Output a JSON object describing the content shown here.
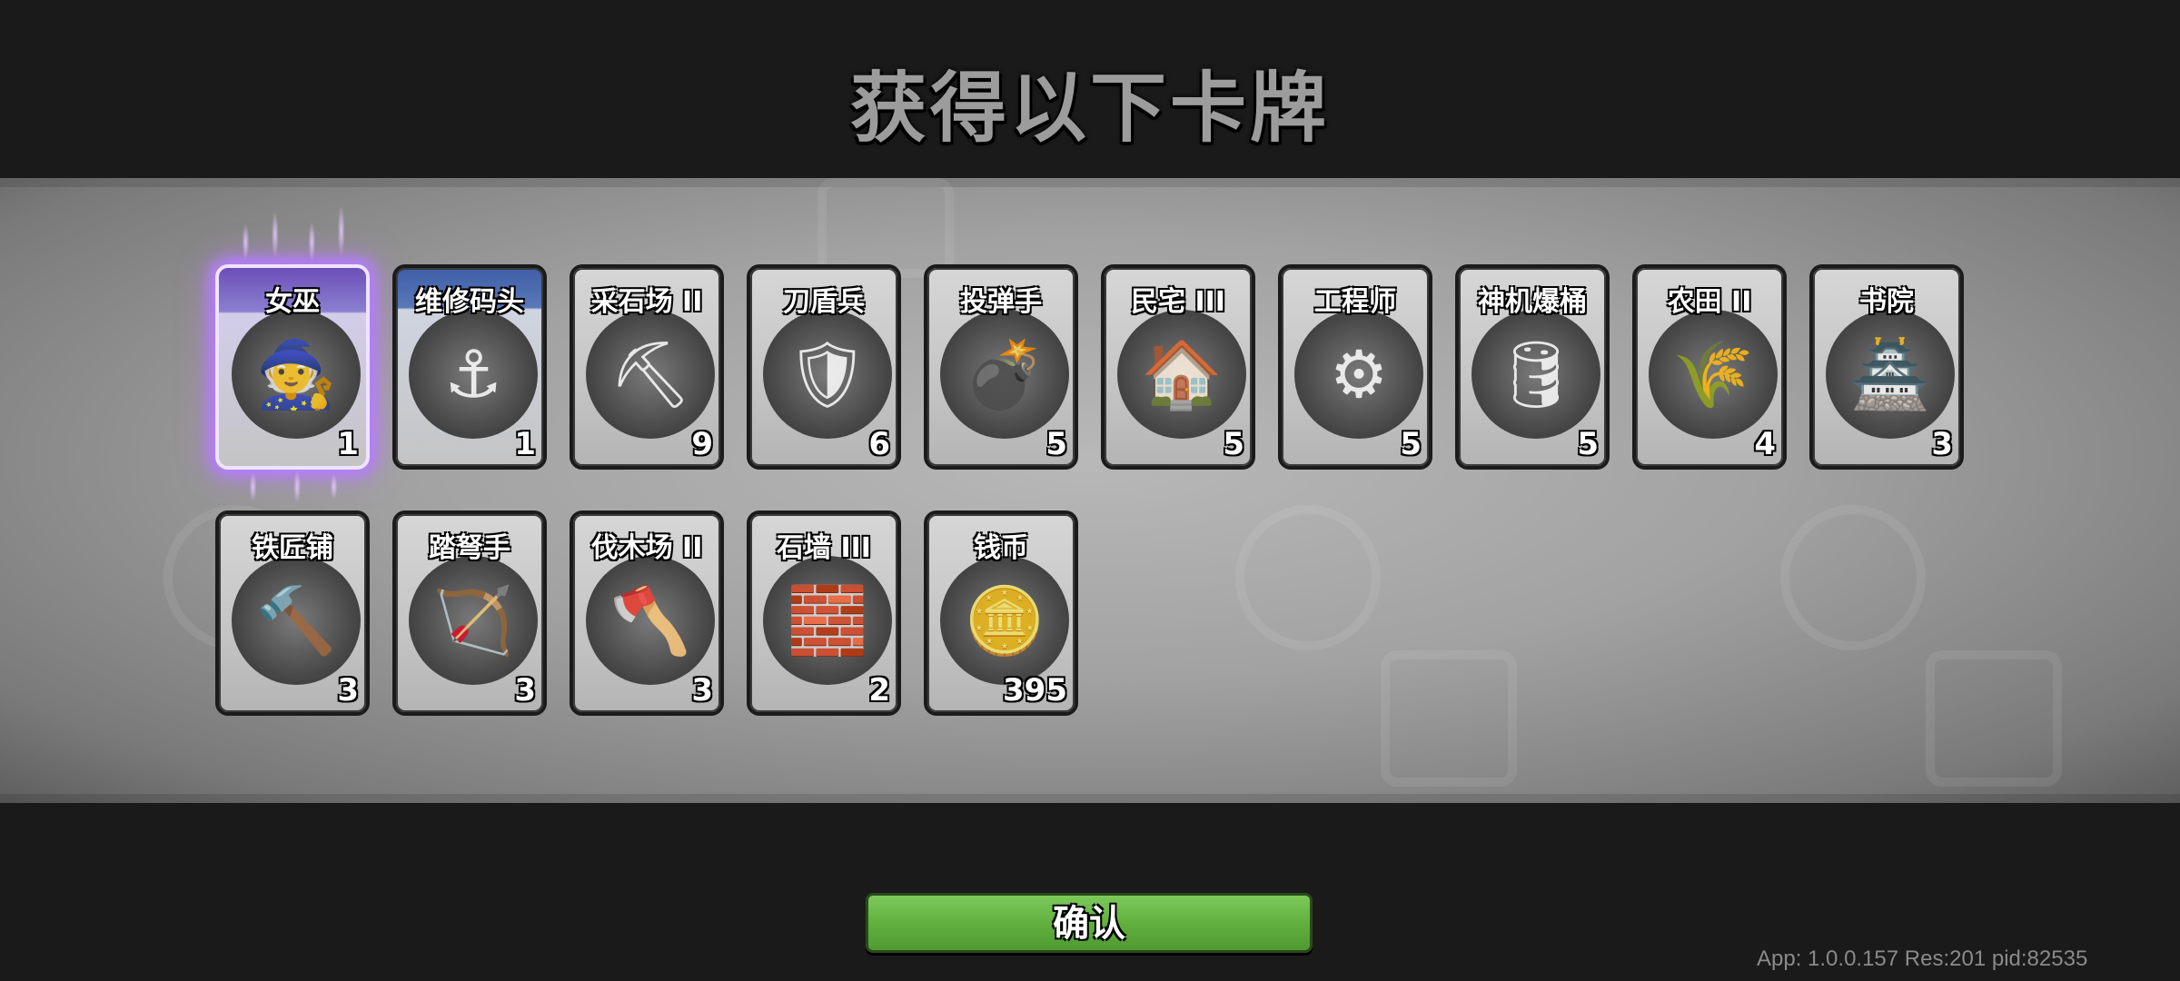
{
  "header": {
    "title": "获得以下卡牌"
  },
  "cards": [
    {
      "name": "女巫",
      "count": "1",
      "icon": "witch-icon",
      "glyph": "🧙"
    },
    {
      "name": "维修码头",
      "count": "1",
      "icon": "repair-dock-icon",
      "glyph": "⚓"
    },
    {
      "name": "采石场 II",
      "count": "9",
      "icon": "quarry-icon",
      "glyph": "⛏"
    },
    {
      "name": "刀盾兵",
      "count": "6",
      "icon": "sword-shield-soldier-icon",
      "glyph": "🛡"
    },
    {
      "name": "投弹手",
      "count": "5",
      "icon": "bomber-icon",
      "glyph": "💣"
    },
    {
      "name": "民宅 III",
      "count": "5",
      "icon": "house-icon",
      "glyph": "🏠"
    },
    {
      "name": "工程师",
      "count": "5",
      "icon": "engineer-icon",
      "glyph": "⚙"
    },
    {
      "name": "神机爆桶",
      "count": "5",
      "icon": "explosive-barrel-icon",
      "glyph": "🛢"
    },
    {
      "name": "农田 II",
      "count": "4",
      "icon": "farm-icon",
      "glyph": "🌾"
    },
    {
      "name": "书院",
      "count": "3",
      "icon": "academy-icon",
      "glyph": "🏯"
    },
    {
      "name": "铁匠铺",
      "count": "3",
      "icon": "blacksmith-icon",
      "glyph": "🔨"
    },
    {
      "name": "踏弩手",
      "count": "3",
      "icon": "crossbowman-icon",
      "glyph": "🏹"
    },
    {
      "name": "伐木场 II",
      "count": "3",
      "icon": "lumber-mill-icon",
      "glyph": "🪓"
    },
    {
      "name": "石墙 III",
      "count": "2",
      "icon": "stone-wall-icon",
      "glyph": "🧱"
    },
    {
      "name": "钱币",
      "count": "395",
      "icon": "coin-icon",
      "glyph": "🪙"
    }
  ],
  "footer": {
    "confirm_label": "确认",
    "version_text": "App: 1.0.0.157 Res:201 pid:82535"
  },
  "colors": {
    "confirm_button": "#5fae3e",
    "witch_glow": "#b57cff",
    "repair_header": "#3e5ea6"
  }
}
